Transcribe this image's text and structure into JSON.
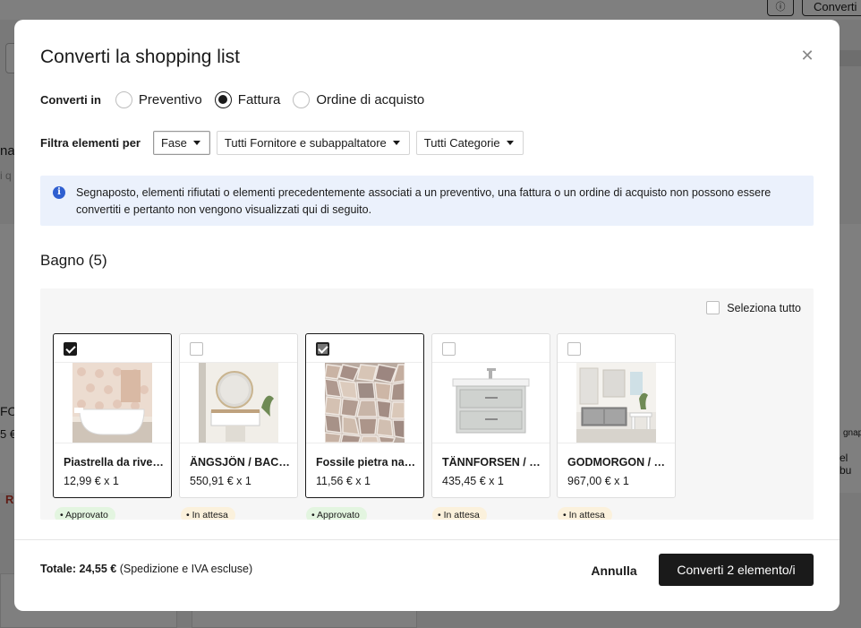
{
  "background": {
    "top_convert_label": "Converti",
    "left_fragments": [
      "na",
      "i q",
      "FO",
      "5 €",
      "Ri"
    ],
    "right_fragments": [
      "gnapo",
      "el bu"
    ]
  },
  "modal": {
    "title": "Converti la shopping list",
    "convert_in_label": "Converti in",
    "convert_options": [
      {
        "label": "Preventivo",
        "checked": false
      },
      {
        "label": "Fattura",
        "checked": true
      },
      {
        "label": "Ordine di acquisto",
        "checked": false
      }
    ],
    "filter_label": "Filtra elementi per",
    "filters": {
      "phase": "Fase",
      "supplier": "Tutti Fornitore e subappaltatore",
      "category": "Tutti Categorie"
    },
    "info_text": "Segnaposto, elementi rifiutati o elementi precedentemente associati a un preventivo, una fattura o un ordine di acquisto non possono essere convertiti e pertanto non vengono visualizzati qui di seguito.",
    "section_title": "Bagno (5)",
    "select_all_label": "Seleziona tutto",
    "items": [
      {
        "name": "Piastrella da rivestimento",
        "price": "12,99 € x 1",
        "status": "Approvato",
        "checked": true
      },
      {
        "name": "ÄNGSJÖN / BACKSJÖN",
        "price": "550,91 € x 1",
        "status": "In attesa",
        "checked": false
      },
      {
        "name": "Fossile pietra naturale",
        "price": "11,56 € x 1",
        "status": "Approvato",
        "checked": true
      },
      {
        "name": "TÄNNFORSEN / RÄNNILEN",
        "price": "435,45 € x 1",
        "status": "In attesa",
        "checked": false
      },
      {
        "name": "GODMORGON / BRAVIKEN",
        "price": "967,00 € x 1",
        "status": "In attesa",
        "checked": false
      }
    ],
    "footer": {
      "total_label": "Totale: 24,55 €",
      "total_note": " (Spedizione e IVA escluse)",
      "cancel_label": "Annulla",
      "submit_label": "Converti 2 elemento/i"
    }
  },
  "colors": {
    "primary": "#1a1a1a",
    "info_bg": "#ebf1fc",
    "info_icon": "#2f5fd0",
    "approved_bg": "#e3f5e0",
    "pending_bg": "#fbf1dc"
  }
}
